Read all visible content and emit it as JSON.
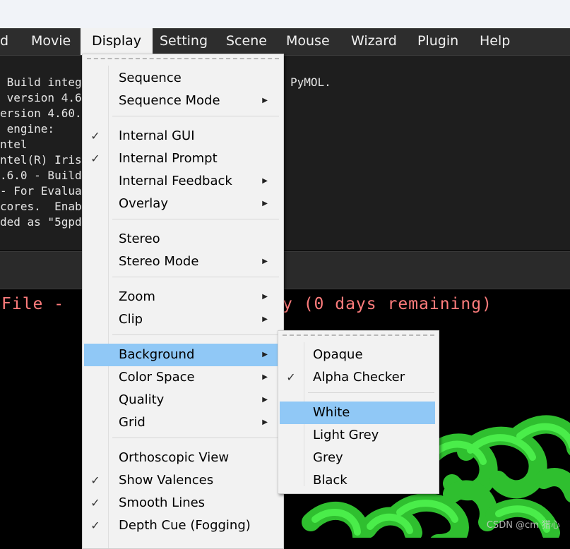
{
  "menubar": {
    "items": [
      {
        "label": "d"
      },
      {
        "label": "Movie"
      },
      {
        "label": "Display",
        "active": true
      },
      {
        "label": "Setting"
      },
      {
        "label": "Scene"
      },
      {
        "label": "Mouse"
      },
      {
        "label": "Wizard"
      },
      {
        "label": "Plugin"
      },
      {
        "label": "Help"
      }
    ]
  },
  "console": {
    "lines": [
      " Build integ",
      " version 4.6",
      "ersion 4.60.",
      " engine:",
      "ntel",
      "ntel(R) Iris",
      ".6.0 - Build",
      "- For Evalua",
      "cores.  Enab",
      "ded as \"5gpd",
      "PyMOL."
    ]
  },
  "viewer": {
    "message_left": "File -",
    "message_right": "y (0 days remaining)",
    "watermark": "CSDN @cm 猎心",
    "molecule_color": "#3cdc3c"
  },
  "display_menu": {
    "items": [
      {
        "label": "Sequence",
        "checked": false,
        "submenu": false
      },
      {
        "label": "Sequence Mode",
        "checked": false,
        "submenu": true
      },
      {
        "label": "Internal GUI",
        "checked": true,
        "submenu": false
      },
      {
        "label": "Internal Prompt",
        "checked": true,
        "submenu": false
      },
      {
        "label": "Internal Feedback",
        "checked": false,
        "submenu": true
      },
      {
        "label": "Overlay",
        "checked": false,
        "submenu": true
      },
      {
        "label": "Stereo",
        "checked": false,
        "submenu": false
      },
      {
        "label": "Stereo Mode",
        "checked": false,
        "submenu": true
      },
      {
        "label": "Zoom",
        "checked": false,
        "submenu": true
      },
      {
        "label": "Clip",
        "checked": false,
        "submenu": true
      },
      {
        "label": "Background",
        "checked": false,
        "submenu": true,
        "highlighted": true
      },
      {
        "label": "Color Space",
        "checked": false,
        "submenu": true
      },
      {
        "label": "Quality",
        "checked": false,
        "submenu": true
      },
      {
        "label": "Grid",
        "checked": false,
        "submenu": true
      },
      {
        "label": "Orthoscopic View",
        "checked": false,
        "submenu": false
      },
      {
        "label": "Show Valences",
        "checked": true,
        "submenu": false
      },
      {
        "label": "Smooth Lines",
        "checked": true,
        "submenu": false
      },
      {
        "label": "Depth Cue (Fogging)",
        "checked": true,
        "submenu": false
      }
    ]
  },
  "background_submenu": {
    "items": [
      {
        "label": "Opaque",
        "checked": false
      },
      {
        "label": "Alpha Checker",
        "checked": true
      },
      {
        "label": "White",
        "checked": false,
        "highlighted": true
      },
      {
        "label": "Light Grey",
        "checked": false
      },
      {
        "label": "Grey",
        "checked": false
      },
      {
        "label": "Black",
        "checked": false
      }
    ]
  },
  "glyphs": {
    "check": "✓",
    "arrow": "▶"
  },
  "colors": {
    "highlight": "#90c8f6",
    "menu_bg": "#f2f2f2",
    "message": "#ff7c7c"
  }
}
